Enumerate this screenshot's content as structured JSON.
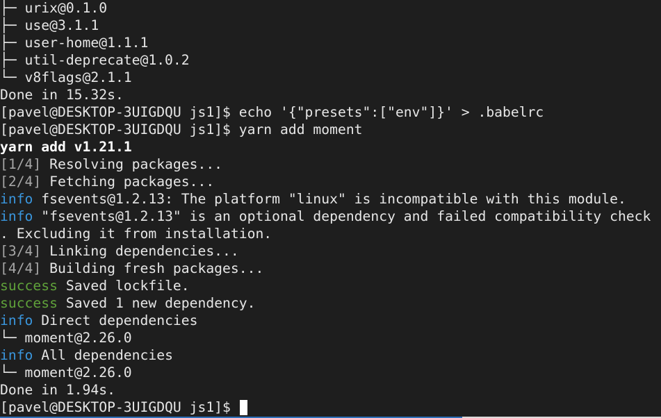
{
  "terminal": {
    "lines": [
      [
        {
          "t": "├─ urix@0.1.0",
          "c": "fg"
        }
      ],
      [
        {
          "t": "├─ use@3.1.1",
          "c": "fg"
        }
      ],
      [
        {
          "t": "├─ user-home@1.1.1",
          "c": "fg"
        }
      ],
      [
        {
          "t": "├─ util-deprecate@1.0.2",
          "c": "fg"
        }
      ],
      [
        {
          "t": "└─ v8flags@2.1.1",
          "c": "fg"
        }
      ],
      [
        {
          "t": "Done in 15.32s.",
          "c": "fg"
        }
      ],
      [
        {
          "t": "[pavel@DESKTOP-3UIGDQU js1]$ echo '{\"presets\":[\"env\"]}' > .babelrc",
          "c": "fg"
        }
      ],
      [
        {
          "t": "[pavel@DESKTOP-3UIGDQU js1]$ yarn add moment",
          "c": "fg"
        }
      ],
      [
        {
          "t": "yarn add v1.21.1",
          "c": "bold"
        }
      ],
      [
        {
          "t": "[1/4]",
          "c": "gray"
        },
        {
          "t": " Resolving packages...",
          "c": "fg"
        }
      ],
      [
        {
          "t": "[2/4]",
          "c": "gray"
        },
        {
          "t": " Fetching packages...",
          "c": "fg"
        }
      ],
      [
        {
          "t": "info",
          "c": "blue"
        },
        {
          "t": " fsevents@1.2.13: The platform \"linux\" is incompatible with this module.",
          "c": "fg"
        }
      ],
      [
        {
          "t": "info",
          "c": "blue"
        },
        {
          "t": " \"fsevents@1.2.13\" is an optional dependency and failed compatibility check",
          "c": "fg"
        }
      ],
      [
        {
          "t": ". Excluding it from installation.",
          "c": "fg"
        }
      ],
      [
        {
          "t": "[3/4]",
          "c": "gray"
        },
        {
          "t": " Linking dependencies...",
          "c": "fg"
        }
      ],
      [
        {
          "t": "[4/4]",
          "c": "gray"
        },
        {
          "t": " Building fresh packages...",
          "c": "fg"
        }
      ],
      [
        {
          "t": "success",
          "c": "green"
        },
        {
          "t": " Saved lockfile.",
          "c": "fg"
        }
      ],
      [
        {
          "t": "success",
          "c": "green"
        },
        {
          "t": " Saved 1 new dependency.",
          "c": "fg"
        }
      ],
      [
        {
          "t": "info",
          "c": "blue"
        },
        {
          "t": " Direct dependencies",
          "c": "fg"
        }
      ],
      [
        {
          "t": "└─ moment@2.26.0",
          "c": "fg"
        }
      ],
      [
        {
          "t": "info",
          "c": "blue"
        },
        {
          "t": " All dependencies",
          "c": "fg"
        }
      ],
      [
        {
          "t": "└─ moment@2.26.0",
          "c": "fg"
        }
      ],
      [
        {
          "t": "Done in 1.94s.",
          "c": "fg"
        }
      ]
    ],
    "prompt": "[pavel@DESKTOP-3UIGDQU js1]$ ",
    "colors": {
      "background": "#1e1e1e",
      "foreground": "#e6e6e6",
      "info": "#3a96dd",
      "success": "#5fa13a",
      "step": "#a7a7a7"
    }
  }
}
